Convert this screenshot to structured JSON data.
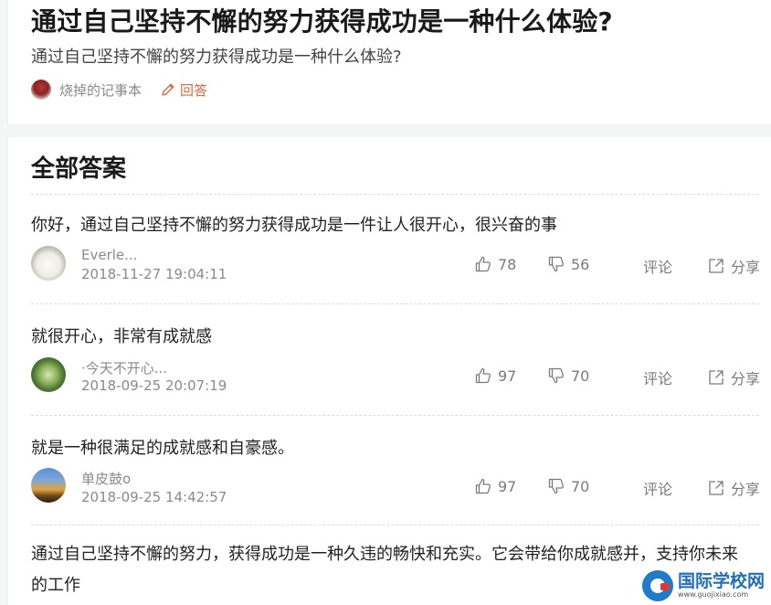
{
  "question": {
    "title": "通过自己坚持不懈的努力获得成功是一种什么体验?",
    "description": "通过自己坚持不懈的努力获得成功是一种什么体验?",
    "author": "烧掉的记事本",
    "reply_label": "回答"
  },
  "answers_section": {
    "heading": "全部答案",
    "actions": {
      "comment_label": "评论",
      "share_label": "分享"
    },
    "answers": [
      {
        "text": "你好，通过自己坚持不懈的努力获得成功是一件让人很开心，很兴奋的事",
        "user": "Everle...",
        "time": "2018-11-27 19:04:11",
        "likes": "78",
        "dislikes": "56"
      },
      {
        "text": "就很开心，非常有成就感",
        "user": "·今天不开心...",
        "time": "2018-09-25 20:07:19",
        "likes": "97",
        "dislikes": "70"
      },
      {
        "text": "就是一种很满足的成就感和自豪感。",
        "user": "单皮鼓o",
        "time": "2018-09-25 14:42:57",
        "likes": "97",
        "dislikes": "70"
      },
      {
        "text": "通过自己坚持不懈的努力，获得成功是一种久违的畅快和充实。它会带给你成就感并，支持你未来的工作"
      }
    ]
  },
  "watermark": {
    "name": "国际学校网",
    "url": "www.guojixiao.com"
  },
  "colors": {
    "accent": "#e0683a",
    "text_muted": "#8a8a8a",
    "logo_blue": "#1e6fb8"
  }
}
